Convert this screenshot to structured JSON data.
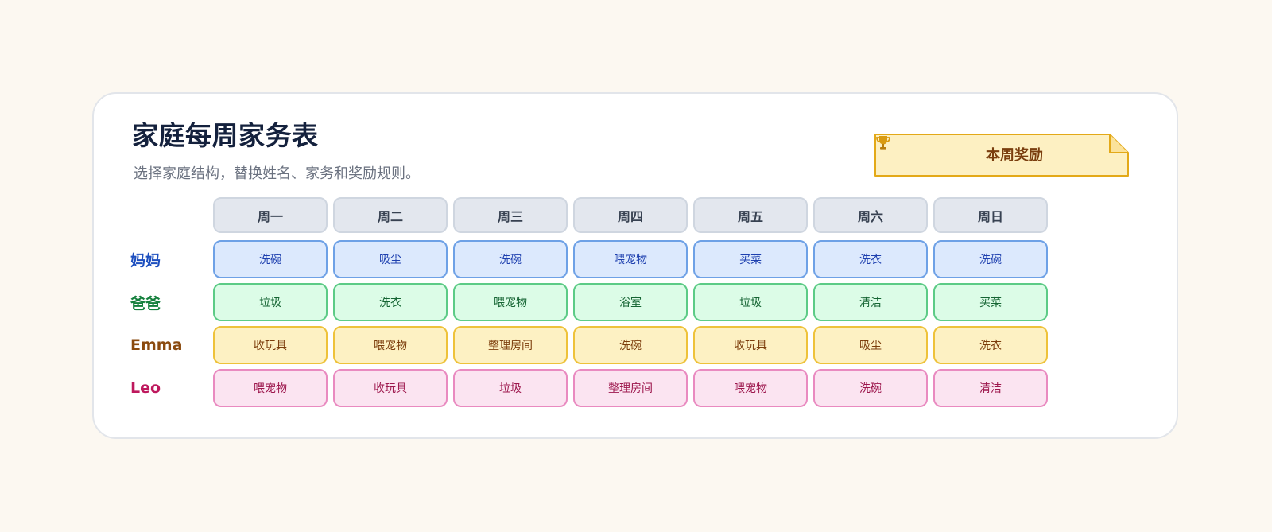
{
  "title": "家庭每周家务表",
  "subtitle": "选择家庭结构，替换姓名、家务和奖励规则。",
  "reward": {
    "label": "本周奖励",
    "icon": "trophy-icon"
  },
  "days": [
    "周一",
    "周二",
    "周三",
    "周四",
    "周五",
    "周六",
    "周日"
  ],
  "members": [
    {
      "name": "妈妈",
      "color": "#1d4fbf",
      "fill": "#dce9fd",
      "border": "#6ea1e6",
      "text": "#1e40af",
      "chores": [
        "洗碗",
        "吸尘",
        "洗碗",
        "喂宠物",
        "买菜",
        "洗衣",
        "洗碗"
      ]
    },
    {
      "name": "爸爸",
      "color": "#15803d",
      "fill": "#dcfce7",
      "border": "#5ccb86",
      "text": "#166534",
      "chores": [
        "垃圾",
        "洗衣",
        "喂宠物",
        "浴室",
        "垃圾",
        "清洁",
        "买菜"
      ]
    },
    {
      "name": "Emma",
      "color": "#8a4a0f",
      "fill": "#fdf1c3",
      "border": "#eec23a",
      "text": "#7c3d0c",
      "chores": [
        "收玩具",
        "喂宠物",
        "整理房间",
        "洗碗",
        "收玩具",
        "吸尘",
        "洗衣"
      ]
    },
    {
      "name": "Leo",
      "color": "#be185d",
      "fill": "#fbe4f1",
      "border": "#e98ac0",
      "text": "#9d174d",
      "chores": [
        "喂宠物",
        "收玩具",
        "垃圾",
        "整理房间",
        "喂宠物",
        "洗碗",
        "清洁"
      ]
    }
  ]
}
